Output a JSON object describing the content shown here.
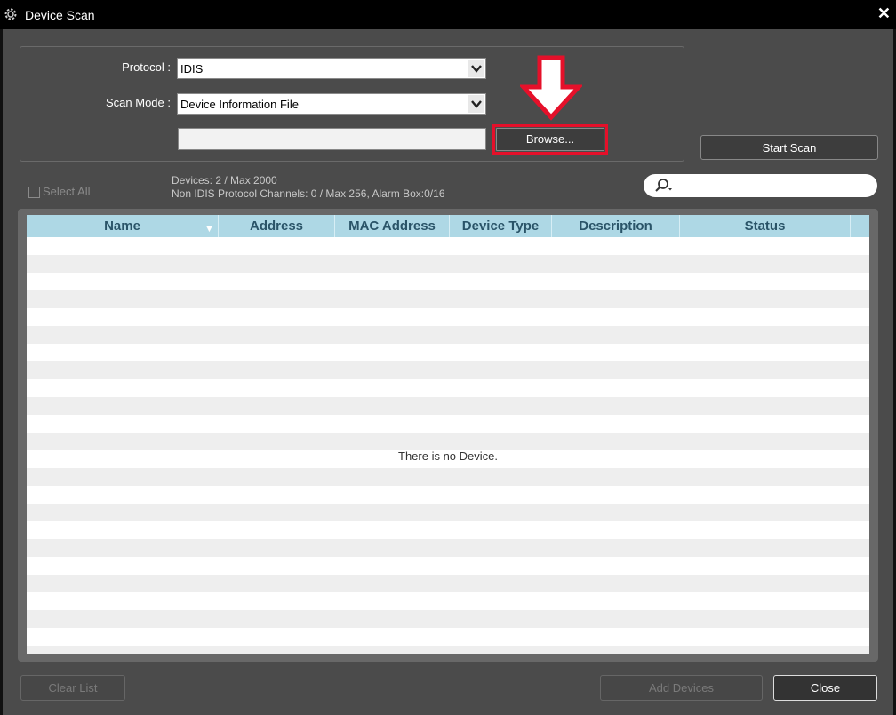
{
  "window": {
    "title": "Device Scan",
    "close_glyph": "✕"
  },
  "form": {
    "protocol_label": "Protocol :",
    "protocol_value": "IDIS",
    "scan_mode_label": "Scan Mode :",
    "scan_mode_value": "Device Information File",
    "file_path_value": "",
    "browse_label": "Browse...",
    "start_scan_label": "Start Scan"
  },
  "status": {
    "select_all_label": "Select All",
    "devices_text": "Devices: 2 / Max 2000",
    "channels_text": "Non IDIS Protocol Channels: 0 / Max 256, Alarm Box:0/16",
    "search_placeholder": ""
  },
  "table": {
    "columns": [
      "Name",
      "Address",
      "MAC Address",
      "Device Type",
      "Description",
      "Status"
    ],
    "rows": [],
    "empty_message": "There is no Device."
  },
  "footer": {
    "clear_list_label": "Clear List",
    "add_devices_label": "Add Devices",
    "close_label": "Close"
  },
  "icons": {
    "title": "gear-icon",
    "search": "search-icon",
    "annotation": "down-arrow-annotation-icon",
    "dropdown": "chevron-down-icon"
  },
  "colors": {
    "titlebar": "#000000",
    "background": "#4b4b4b",
    "table_header": "#aed8e5",
    "table_header_text": "#2a5468",
    "highlight": "#e5102a"
  }
}
